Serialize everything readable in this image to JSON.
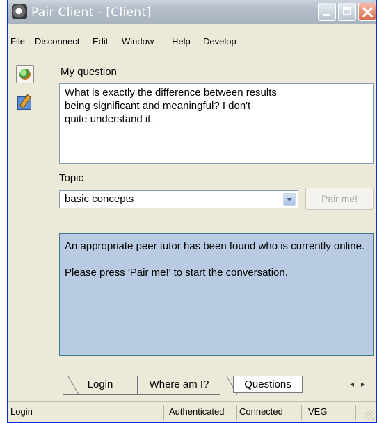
{
  "window": {
    "title": "Pair Client - [Client]"
  },
  "menu": [
    "File",
    "Disconnect",
    "Edit",
    "Window",
    "Help",
    "Develop"
  ],
  "question": {
    "label": "My question",
    "text": "What is exactly the difference between results\nbeing significant and meaningful? I don't\nquite understand it."
  },
  "topic": {
    "label": "Topic",
    "selected": "basic concepts",
    "pair_button": "Pair me!"
  },
  "status_message": {
    "line1": "An appropriate peer tutor has been found who is currently online.",
    "line2": "Please press 'Pair me!' to start the conversation."
  },
  "tabs": [
    "Login",
    "Where am I?",
    "Questions"
  ],
  "tab_nav": {
    "prev": "◂",
    "next": "▸"
  },
  "statusbar": {
    "left": "Login",
    "auth": "Authenticated",
    "conn": "Connected",
    "mode": "VEG"
  },
  "icons": {
    "app": "app-icon",
    "tool1": "globe-icon",
    "tool2": "edit-icon"
  },
  "colors": {
    "status_panel_bg": "#b8cbe3",
    "window_bg": "#ece9d8"
  }
}
